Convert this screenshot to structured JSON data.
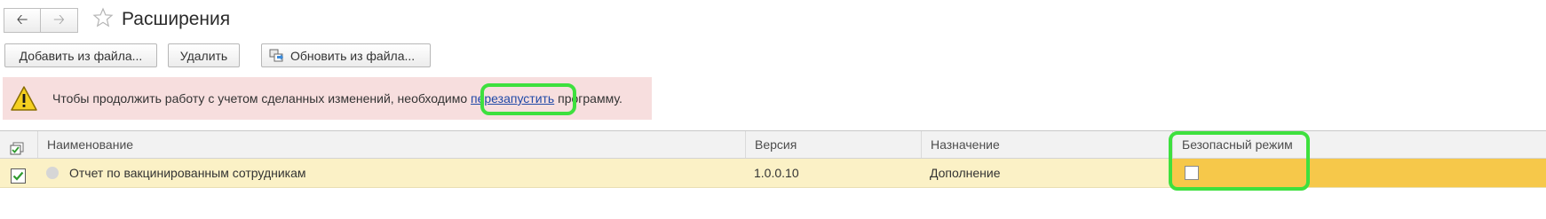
{
  "header": {
    "back_icon": "arrow-left-icon",
    "forward_icon": "arrow-right-icon",
    "favorite_icon": "star-outline-icon",
    "title": "Расширения"
  },
  "toolbar": {
    "add_from_file": "Добавить из файла...",
    "delete": "Удалить",
    "update_from_file": "Обновить из файла...",
    "update_icon": "update-from-file-icon"
  },
  "warning": {
    "icon": "warning-triangle-icon",
    "text_before": "Чтобы продолжить работу с учетом сделанных изменений, необходимо ",
    "link": "перезапустить",
    "text_after": " программу.",
    "background": "#f7dede"
  },
  "table": {
    "columns": {
      "check_icon": "select-all-icon",
      "name": "Наименование",
      "version": "Версия",
      "purpose": "Назначение",
      "safe_mode": "Безопасный режим"
    },
    "rows": [
      {
        "active": true,
        "status_icon": "status-dot-icon",
        "name": "Отчет по вакцинированным сотрудникам",
        "version": "1.0.0.10",
        "purpose": "Дополнение",
        "safe_mode": false
      }
    ]
  },
  "colors": {
    "highlight": "#3ee03e",
    "selected_row": "#fbf1c6",
    "selected_cell": "#f6c84a",
    "link": "#2049a7",
    "checkbox_green": "#2e9b2e"
  }
}
